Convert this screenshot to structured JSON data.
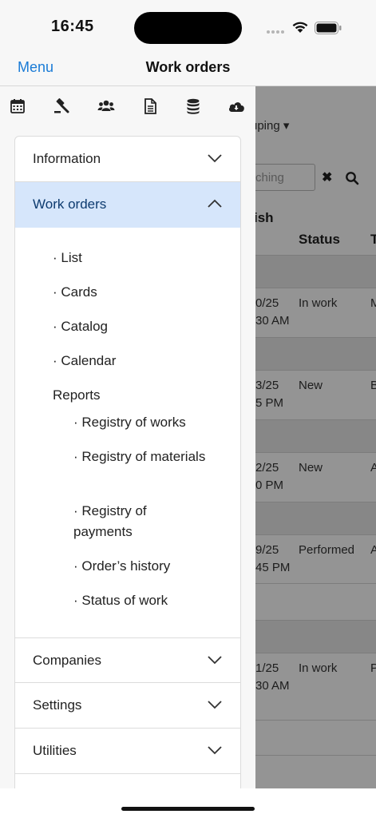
{
  "status_bar": {
    "time": "16:45"
  },
  "nav": {
    "menu_label": "Menu",
    "title": "Work orders"
  },
  "background": {
    "grouping_label": "uping",
    "search_placeholder": "ching",
    "clear_label": "✖",
    "header_partial": "ish",
    "col_status": "Status",
    "col_t": "T",
    "rows": [
      {
        "date1": "0/25",
        "date2": "30 AM",
        "status": "In work",
        "t": "M"
      },
      {
        "date1": "3/25",
        "date2": "5 PM",
        "status": "New",
        "t": "B"
      },
      {
        "date1": "2/25",
        "date2": "0 PM",
        "status": "New",
        "t": "A"
      },
      {
        "date1": "9/25",
        "date2": "45 PM",
        "status": "Performed",
        "t": "A"
      },
      {
        "date1": "1/25",
        "date2": "30 AM",
        "status": "In work",
        "t": "P"
      }
    ]
  },
  "toolbar_icons": [
    "calendar-icon",
    "gavel-icon",
    "users-icon",
    "document-icon",
    "database-icon",
    "cloud-download-icon"
  ],
  "menu": {
    "information": "Information",
    "work_orders": "Work orders",
    "work_orders_items": [
      "· List",
      "· Cards",
      "· Catalog",
      "· Calendar"
    ],
    "reports_label": "Reports",
    "reports_items": [
      "· Registry of works",
      "· Registry of materials",
      "· Registry of payments",
      "· Order’s history",
      "· Status of work"
    ],
    "companies": "Companies",
    "settings": "Settings",
    "utilities": "Utilities"
  },
  "colors": {
    "accent": "#1a7bd6",
    "active_bg": "#d6e6fb",
    "active_text": "#0d3b6f"
  }
}
